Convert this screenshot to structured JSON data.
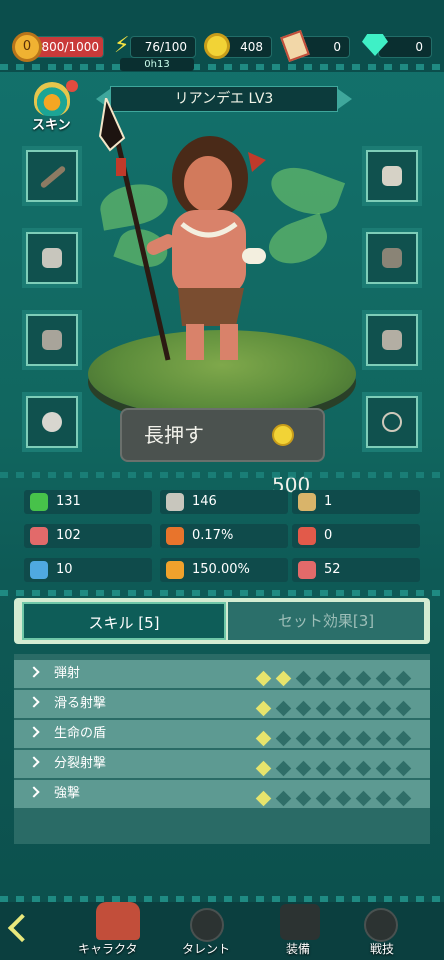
{
  "top": {
    "level": "0",
    "hp": "800/1000",
    "energy": "76/100",
    "energy_timer": "0h13",
    "gold": "408",
    "tickets": "0",
    "gems": "0"
  },
  "skin_label": "スキン",
  "hero": {
    "title": "リアンデエ LV3"
  },
  "press_button": {
    "label": "長押す",
    "cost": "500"
  },
  "stats": [
    {
      "icon": "heart-icon",
      "value": "131"
    },
    {
      "icon": "spear-icon",
      "value": "146"
    },
    {
      "icon": "shield-icon",
      "value": "1"
    },
    {
      "icon": "meat-icon",
      "value": "102"
    },
    {
      "icon": "fox-mask-icon",
      "value": "0.17%"
    },
    {
      "icon": "pentagon-icon",
      "value": "0"
    },
    {
      "icon": "bow-icon",
      "value": "10"
    },
    {
      "icon": "burst-icon",
      "value": "150.00%"
    },
    {
      "icon": "drumstick-icon",
      "value": "52"
    }
  ],
  "tabs": {
    "skills": "スキル [5]",
    "set_bonus": "セット効果[3]"
  },
  "skills": [
    {
      "name": "弾射",
      "level": 2
    },
    {
      "name": "滑る射撃",
      "level": 1
    },
    {
      "name": "生命の盾",
      "level": 1
    },
    {
      "name": "分裂射撃",
      "level": 1
    },
    {
      "name": "強撃",
      "level": 1
    }
  ],
  "nav": {
    "character": "キャラクタ",
    "talent": "タレント",
    "equipment": "装備",
    "combat": "戦技"
  },
  "colors": {
    "background": "#11665f",
    "accent": "#e7e46c",
    "hp": "#c93a3a"
  }
}
